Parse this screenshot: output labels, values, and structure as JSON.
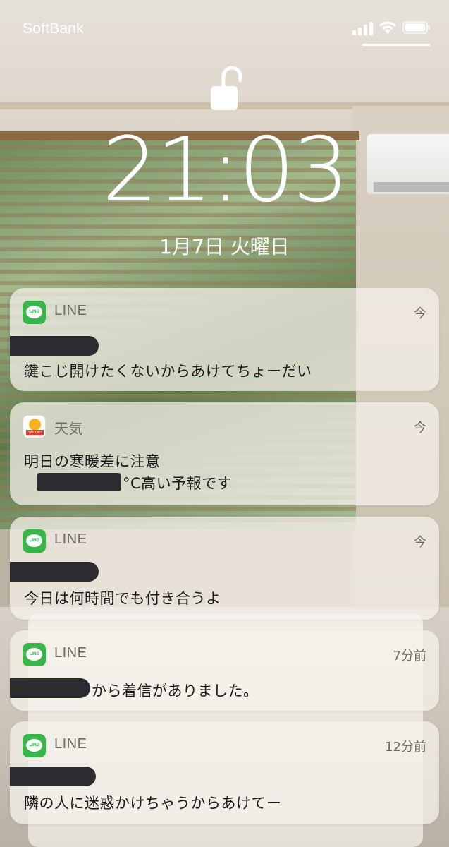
{
  "status_bar": {
    "carrier": "SoftBank"
  },
  "lock_screen": {
    "time": "21:03",
    "date": "1月7日 火曜日"
  },
  "notifications": [
    {
      "app": "LINE",
      "icon": "line-app-icon",
      "time": "今",
      "body": "鍵こじ開けたくないからあけてちょーだい",
      "sender_redacted": true
    },
    {
      "app": "天気",
      "icon": "weather-app-icon",
      "time": "今",
      "title": "明日の寒暖差に注意",
      "body": "°C高い予報です",
      "sender_redacted": true
    },
    {
      "app": "LINE",
      "icon": "line-app-icon",
      "time": "今",
      "body": "今日は何時間でも付き合うよ",
      "sender_redacted": true
    },
    {
      "app": "LINE",
      "icon": "line-app-icon",
      "time": "7分前",
      "body": "から着信がありました。",
      "sender_redacted": true
    },
    {
      "app": "LINE",
      "icon": "line-app-icon",
      "time": "12分前",
      "body": "隣の人に迷惑かけちゃうからあけてー",
      "sender_redacted": true
    }
  ],
  "icons": {
    "line_label": "LINE",
    "weather_label": "YAHOO!"
  }
}
